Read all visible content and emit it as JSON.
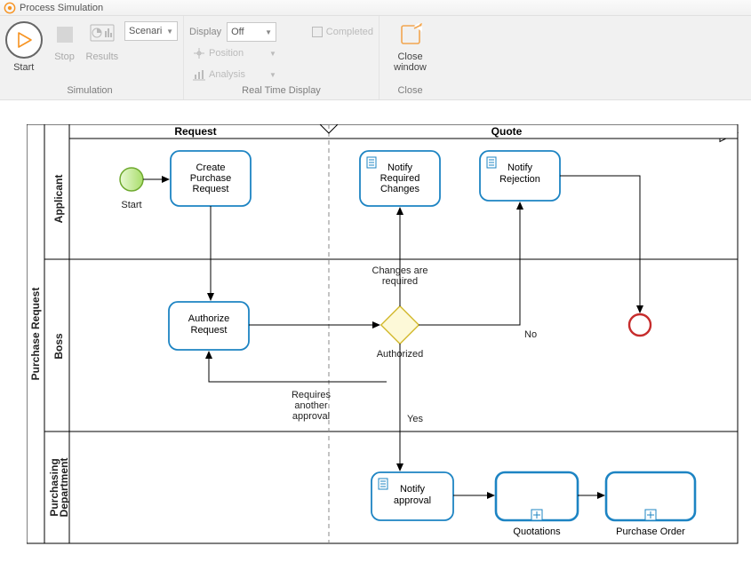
{
  "window": {
    "title": "Process Simulation"
  },
  "ribbon": {
    "groups": {
      "simulation": {
        "caption": "Simulation",
        "start": "Start",
        "stop": "Stop",
        "results": "Results",
        "scenario_value": "Scenari"
      },
      "rtd": {
        "caption": "Real Time Display",
        "display_label": "Display",
        "display_value": "Off",
        "completed": "Completed",
        "position": "Position",
        "analysis": "Analysis"
      },
      "close": {
        "caption": "Close",
        "close_label": "Close",
        "close_label2": "window"
      }
    }
  },
  "pool": {
    "name": "Purchase Request"
  },
  "phases": {
    "request": "Request",
    "quote": "Quote"
  },
  "lanes": {
    "applicant": "Applicant",
    "boss": "Boss",
    "purchasing": "Purchasing\nDepartment"
  },
  "nodes": {
    "start": "Start",
    "create": "Create\nPurchase\nRequest",
    "auth": "Authorize\nRequest",
    "notifychanges": "Notify\nRequired\nChanges",
    "notifyrej": "Notify\nRejection",
    "notifyapp": "Notify\napproval",
    "quotations": "Quotations",
    "po": "Purchase Order"
  },
  "labels": {
    "gateway": "Authorized",
    "changes": "Changes are\nrequired",
    "no": "No",
    "yes": "Yes",
    "requires": "Requires\nanother\napproval"
  }
}
